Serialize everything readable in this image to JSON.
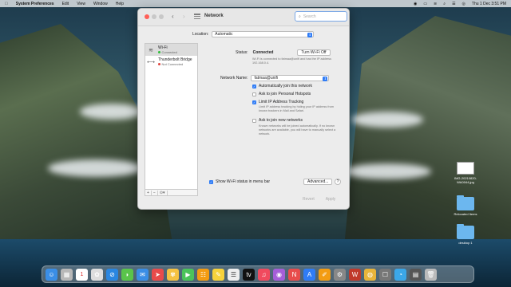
{
  "menubar": {
    "app_name": "System Preferences",
    "menus": [
      "Edit",
      "View",
      "Window",
      "Help"
    ],
    "datetime": "Thu 1 Dec  3:51 PM"
  },
  "window": {
    "title": "Network",
    "search_placeholder": "Search",
    "location_label": "Location:",
    "location_value": "Automatic",
    "services": [
      {
        "name": "Wi-Fi",
        "status": "Connected",
        "status_color": "#2fbf3a"
      },
      {
        "name": "Thunderbolt Bridge",
        "status": "Not Connected",
        "status_color": "#e0443e"
      }
    ],
    "sidebar_buttons": [
      "+",
      "−",
      "⊙▾"
    ],
    "status_label": "Status:",
    "status_value": "Connected",
    "turn_off_button": "Turn Wi-Fi Off",
    "status_desc": "Wi-Fi is connected to fatmaa@unifi and has the IP address 192.168.0.4.",
    "network_name_label": "Network Name:",
    "network_name_value": "fatmaa@unifi",
    "options": [
      {
        "label": "Automatically join this network",
        "checked": true
      },
      {
        "label": "Ask to join Personal Hotspots",
        "checked": false
      },
      {
        "label": "Limit IP Address Tracking",
        "checked": true
      }
    ],
    "tracking_desc": "Limit IP address tracking by hiding your IP address from known trackers in Mail and Safari.",
    "ask_new_label": "Ask to join new networks",
    "ask_new_desc": "Known networks will be joined automatically. If no known networks are available, you will have to manually select a network.",
    "show_wifi_label": "Show Wi-Fi status in menu bar",
    "advanced_button": "Advanced...",
    "help_button": "?",
    "revert_button": "Revert",
    "apply_button": "Apply"
  },
  "desktop": {
    "icons": [
      {
        "label": "IMG-20210820-WA0044.jpg"
      },
      {
        "label": "Relocated Items"
      },
      {
        "label": "desktop 1"
      }
    ]
  }
}
